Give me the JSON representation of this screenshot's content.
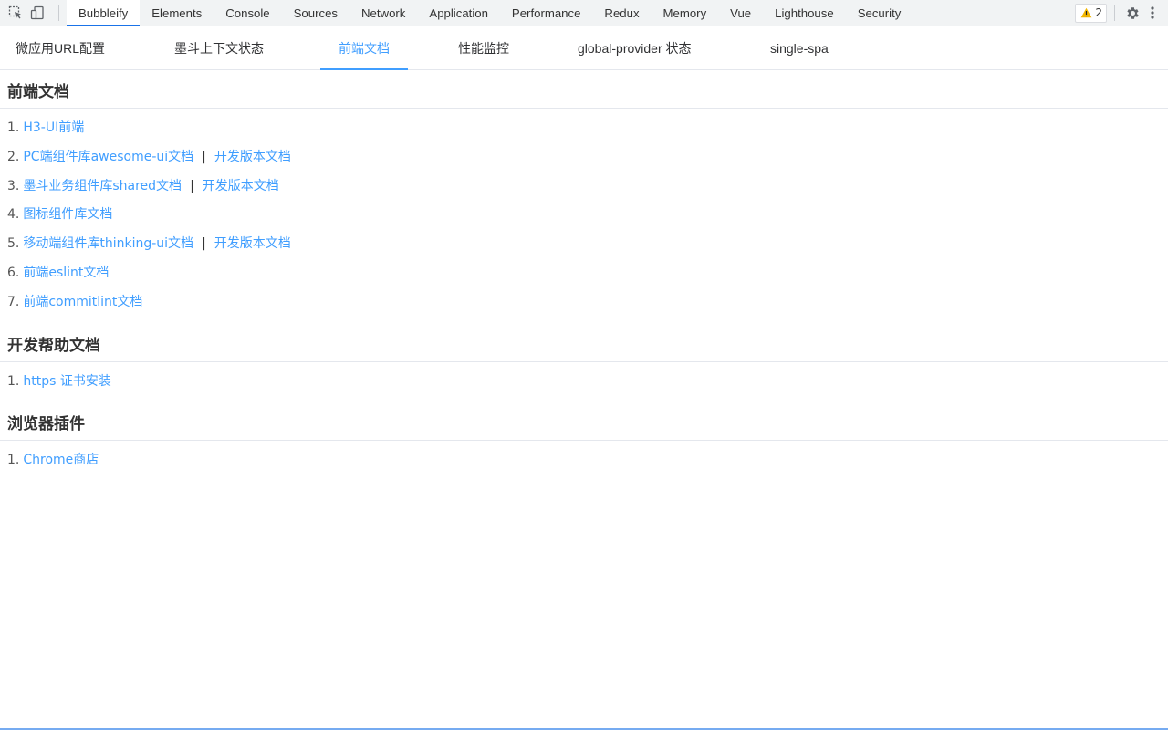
{
  "devtools": {
    "tabs": [
      "Bubbleify",
      "Elements",
      "Console",
      "Sources",
      "Network",
      "Application",
      "Performance",
      "Redux",
      "Memory",
      "Vue",
      "Lighthouse",
      "Security"
    ],
    "active_tab": "Bubbleify",
    "warning_count": "2",
    "icons": [
      "inspect-element-icon",
      "device-toggle-icon",
      "warning-icon",
      "gear-icon",
      "more-vertical-icon"
    ]
  },
  "app_tabs": {
    "items": [
      "微应用URL配置",
      "墨斗上下文状态",
      "前端文档",
      "性能监控",
      "global-provider 状态",
      "single-spa"
    ],
    "active": "前端文档"
  },
  "sections": [
    {
      "title": "前端文档",
      "items": [
        {
          "num": "1.",
          "links": [
            "H3-UI前端"
          ]
        },
        {
          "num": "2.",
          "links": [
            "PC端组件库awesome-ui文档",
            "开发版本文档"
          ]
        },
        {
          "num": "3.",
          "links": [
            "墨斗业务组件库shared文档",
            "开发版本文档"
          ]
        },
        {
          "num": "4.",
          "links": [
            "图标组件库文档"
          ]
        },
        {
          "num": "5.",
          "links": [
            "移动端组件库thinking-ui文档",
            "开发版本文档"
          ]
        },
        {
          "num": "6.",
          "links": [
            "前端eslint文档"
          ]
        },
        {
          "num": "7.",
          "links": [
            "前端commitlint文档"
          ]
        }
      ]
    },
    {
      "title": "开发帮助文档",
      "items": [
        {
          "num": "1.",
          "links": [
            "https 证书安装"
          ]
        }
      ]
    },
    {
      "title": "浏览器插件",
      "items": [
        {
          "num": "1.",
          "links": [
            "Chrome商店"
          ]
        }
      ]
    }
  ],
  "separator": "|",
  "colors": {
    "link": "#409eff",
    "devtools_accent": "#1a73e8",
    "warning": "#f2b600"
  }
}
